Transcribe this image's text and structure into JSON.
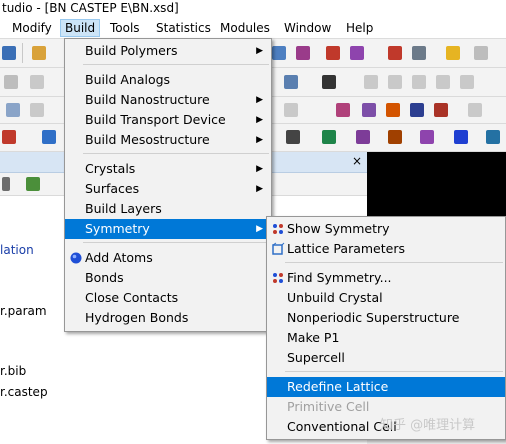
{
  "window": {
    "title": "tudio - [BN CASTEP E\\BN.xsd]"
  },
  "menubar": {
    "items": [
      {
        "label": "Modify"
      },
      {
        "label": "Build"
      },
      {
        "label": "Tools"
      },
      {
        "label": "Statistics"
      },
      {
        "label": "Modules"
      },
      {
        "label": "Window"
      },
      {
        "label": "Help"
      }
    ],
    "active": "Build"
  },
  "panel": {
    "tree": [
      {
        "text": "lation"
      },
      {
        "text": "r.param"
      },
      {
        "text": "r.bib"
      },
      {
        "text": "r.castep"
      }
    ]
  },
  "build_menu": {
    "items": [
      {
        "label": "Build Polymers",
        "submenu": true
      },
      {
        "label": "Build Analogs",
        "submenu": false
      },
      {
        "label": "Build Nanostructure",
        "submenu": true
      },
      {
        "label": "Build Transport Device",
        "submenu": true
      },
      {
        "label": "Build Mesostructure",
        "submenu": true
      },
      {
        "label": "Crystals",
        "submenu": true
      },
      {
        "label": "Surfaces",
        "submenu": true
      },
      {
        "label": "Build Layers",
        "submenu": false
      },
      {
        "label": "Symmetry",
        "submenu": true,
        "highlighted": true
      },
      {
        "label": "Add Atoms",
        "submenu": false
      },
      {
        "label": "Bonds",
        "submenu": false
      },
      {
        "label": "Close Contacts",
        "submenu": false
      },
      {
        "label": "Hydrogen Bonds",
        "submenu": false
      }
    ]
  },
  "symmetry_menu": {
    "items": [
      {
        "label": "Show Symmetry",
        "icon": "symmetry-icon"
      },
      {
        "label": "Lattice Parameters",
        "icon": "lattice-icon"
      },
      {
        "label": "Find Symmetry...",
        "icon": "find-symmetry-icon"
      },
      {
        "label": "Unbuild Crystal"
      },
      {
        "label": "Nonperiodic Superstructure"
      },
      {
        "label": "Make P1"
      },
      {
        "label": "Supercell"
      },
      {
        "label": "Redefine Lattice",
        "highlighted": true
      },
      {
        "label": "Primitive Cell",
        "disabled": true
      },
      {
        "label": "Conventional Cell"
      }
    ]
  },
  "watermark": "知乎 @唯理计算",
  "colors": {
    "highlight": "#0078d7",
    "menu_bg": "#f2f2f2",
    "active_menu": "#cce4f7"
  }
}
